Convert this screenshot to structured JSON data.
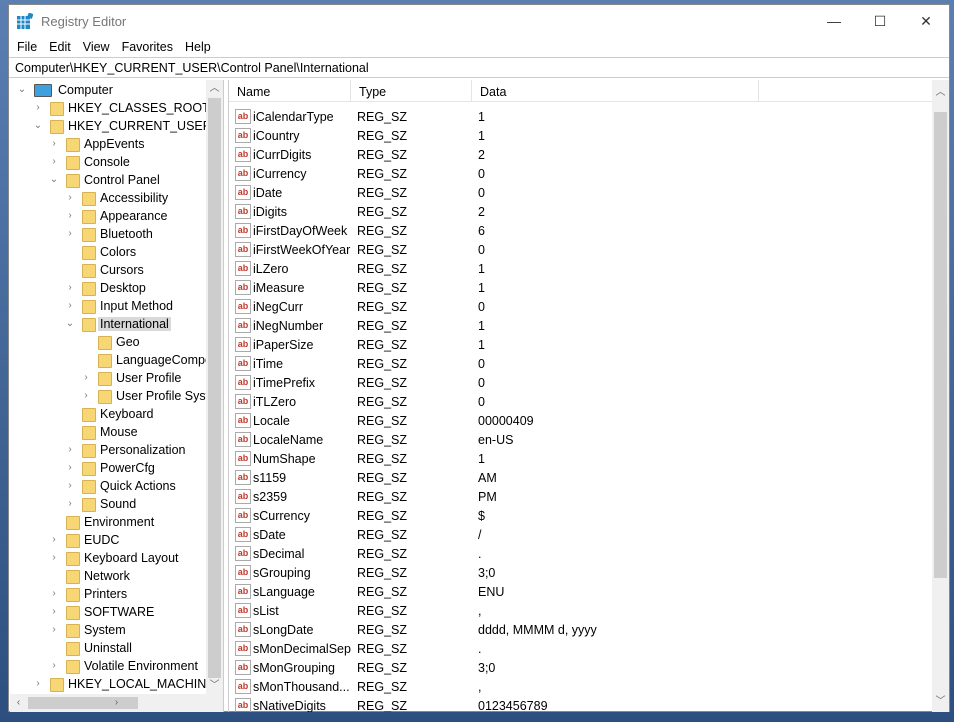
{
  "window": {
    "title": "Registry Editor",
    "minimize": "—",
    "maximize": "☐",
    "close": "✕"
  },
  "menu": [
    "File",
    "Edit",
    "View",
    "Favorites",
    "Help"
  ],
  "address": "Computer\\HKEY_CURRENT_USER\\Control Panel\\International",
  "tree": [
    {
      "label": "Computer",
      "level": 0,
      "state": "expanded",
      "icon": "computer"
    },
    {
      "label": "HKEY_CLASSES_ROOT",
      "level": 1,
      "state": "collapsed"
    },
    {
      "label": "HKEY_CURRENT_USER",
      "level": 1,
      "state": "expanded"
    },
    {
      "label": "AppEvents",
      "level": 2,
      "state": "collapsed"
    },
    {
      "label": "Console",
      "level": 2,
      "state": "collapsed"
    },
    {
      "label": "Control Panel",
      "level": 2,
      "state": "expanded"
    },
    {
      "label": "Accessibility",
      "level": 3,
      "state": "collapsed"
    },
    {
      "label": "Appearance",
      "level": 3,
      "state": "collapsed"
    },
    {
      "label": "Bluetooth",
      "level": 3,
      "state": "collapsed"
    },
    {
      "label": "Colors",
      "level": 3,
      "state": "none"
    },
    {
      "label": "Cursors",
      "level": 3,
      "state": "none"
    },
    {
      "label": "Desktop",
      "level": 3,
      "state": "collapsed"
    },
    {
      "label": "Input Method",
      "level": 3,
      "state": "collapsed"
    },
    {
      "label": "International",
      "level": 3,
      "state": "expanded",
      "selected": true
    },
    {
      "label": "Geo",
      "level": 4,
      "state": "none"
    },
    {
      "label": "LanguageCompo",
      "level": 4,
      "state": "none"
    },
    {
      "label": "User Profile",
      "level": 4,
      "state": "collapsed"
    },
    {
      "label": "User Profile Syste",
      "level": 4,
      "state": "collapsed"
    },
    {
      "label": "Keyboard",
      "level": 3,
      "state": "none"
    },
    {
      "label": "Mouse",
      "level": 3,
      "state": "none"
    },
    {
      "label": "Personalization",
      "level": 3,
      "state": "collapsed"
    },
    {
      "label": "PowerCfg",
      "level": 3,
      "state": "collapsed"
    },
    {
      "label": "Quick Actions",
      "level": 3,
      "state": "collapsed"
    },
    {
      "label": "Sound",
      "level": 3,
      "state": "collapsed"
    },
    {
      "label": "Environment",
      "level": 2,
      "state": "none"
    },
    {
      "label": "EUDC",
      "level": 2,
      "state": "collapsed"
    },
    {
      "label": "Keyboard Layout",
      "level": 2,
      "state": "collapsed"
    },
    {
      "label": "Network",
      "level": 2,
      "state": "none"
    },
    {
      "label": "Printers",
      "level": 2,
      "state": "collapsed"
    },
    {
      "label": "SOFTWARE",
      "level": 2,
      "state": "collapsed"
    },
    {
      "label": "System",
      "level": 2,
      "state": "collapsed"
    },
    {
      "label": "Uninstall",
      "level": 2,
      "state": "none"
    },
    {
      "label": "Volatile Environment",
      "level": 2,
      "state": "collapsed"
    },
    {
      "label": "HKEY_LOCAL_MACHINE",
      "level": 1,
      "state": "collapsed"
    }
  ],
  "columns": [
    "Name",
    "Type",
    "Data"
  ],
  "values": [
    [
      "iCalendarType",
      "REG_SZ",
      "1"
    ],
    [
      "iCountry",
      "REG_SZ",
      "1"
    ],
    [
      "iCurrDigits",
      "REG_SZ",
      "2"
    ],
    [
      "iCurrency",
      "REG_SZ",
      "0"
    ],
    [
      "iDate",
      "REG_SZ",
      "0"
    ],
    [
      "iDigits",
      "REG_SZ",
      "2"
    ],
    [
      "iFirstDayOfWeek",
      "REG_SZ",
      "6"
    ],
    [
      "iFirstWeekOfYear",
      "REG_SZ",
      "0"
    ],
    [
      "iLZero",
      "REG_SZ",
      "1"
    ],
    [
      "iMeasure",
      "REG_SZ",
      "1"
    ],
    [
      "iNegCurr",
      "REG_SZ",
      "0"
    ],
    [
      "iNegNumber",
      "REG_SZ",
      "1"
    ],
    [
      "iPaperSize",
      "REG_SZ",
      "1"
    ],
    [
      "iTime",
      "REG_SZ",
      "0"
    ],
    [
      "iTimePrefix",
      "REG_SZ",
      "0"
    ],
    [
      "iTLZero",
      "REG_SZ",
      "0"
    ],
    [
      "Locale",
      "REG_SZ",
      "00000409"
    ],
    [
      "LocaleName",
      "REG_SZ",
      "en-US"
    ],
    [
      "NumShape",
      "REG_SZ",
      "1"
    ],
    [
      "s1159",
      "REG_SZ",
      "AM"
    ],
    [
      "s2359",
      "REG_SZ",
      "PM"
    ],
    [
      "sCurrency",
      "REG_SZ",
      "$"
    ],
    [
      "sDate",
      "REG_SZ",
      "/"
    ],
    [
      "sDecimal",
      "REG_SZ",
      "."
    ],
    [
      "sGrouping",
      "REG_SZ",
      "3;0"
    ],
    [
      "sLanguage",
      "REG_SZ",
      "ENU"
    ],
    [
      "sList",
      "REG_SZ",
      ","
    ],
    [
      "sLongDate",
      "REG_SZ",
      "dddd, MMMM d, yyyy"
    ],
    [
      "sMonDecimalSep",
      "REG_SZ",
      "."
    ],
    [
      "sMonGrouping",
      "REG_SZ",
      "3;0"
    ],
    [
      "sMonThousand...",
      "REG_SZ",
      ","
    ],
    [
      "sNativeDigits",
      "REG_SZ",
      "0123456789"
    ]
  ],
  "value_icon_text": "ab"
}
